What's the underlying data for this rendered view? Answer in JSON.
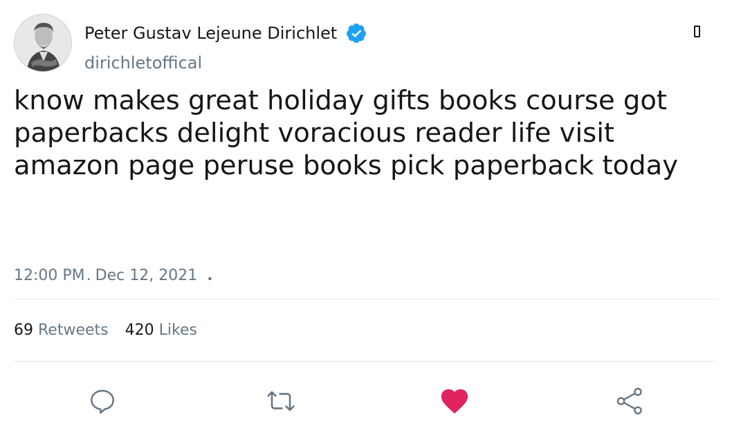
{
  "author": {
    "display_name": "Peter Gustav Lejeune Dirichlet",
    "handle": "dirichletoffical",
    "verified": true,
    "verified_color": "#1da1f2"
  },
  "tweet": {
    "text": "know makes great holiday gifts books course got paperbacks delight voracious reader life visit amazon page peruse books pick paperback today",
    "time": "12:00 PM",
    "date": "Dec 12, 2021"
  },
  "stats": {
    "retweets_count": "69",
    "retweets_label": "Retweets",
    "likes_count": "420",
    "likes_label": "Likes"
  },
  "actions": {
    "reply_icon": "reply-icon",
    "retweet_icon": "retweet-icon",
    "like_icon": "heart-icon",
    "share_icon": "share-icon",
    "liked": true,
    "like_color": "#e0245e",
    "icon_color": "#657786"
  }
}
